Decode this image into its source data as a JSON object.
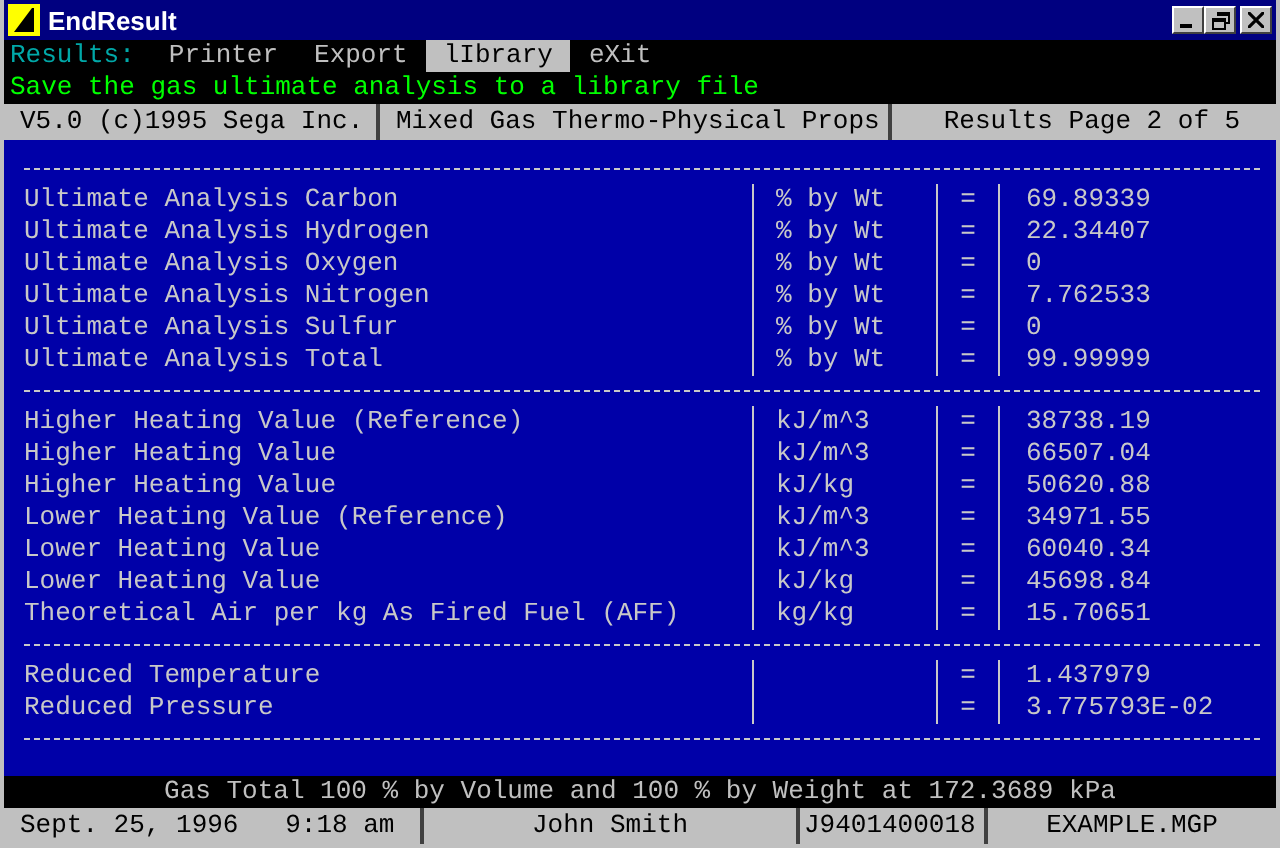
{
  "window": {
    "title": "EndResult"
  },
  "menu": {
    "label": "Results:",
    "items": [
      {
        "label": "Printer",
        "selected": false
      },
      {
        "label": "Export",
        "selected": false
      },
      {
        "label": "lIbrary",
        "selected": true
      },
      {
        "label": "eXit",
        "selected": false
      }
    ]
  },
  "message": "Save the gas ultimate analysis to a library file",
  "info_bar": [
    "V5.0 (c)1995 Sega Inc.",
    "Mixed Gas Thermo-Physical Props",
    "Results Page 2 of 5"
  ],
  "sections": [
    {
      "rows": [
        {
          "label": "Ultimate Analysis Carbon",
          "unit": "% by Wt",
          "relation": "=",
          "value": "69.89339"
        },
        {
          "label": "Ultimate Analysis Hydrogen",
          "unit": "% by Wt",
          "relation": "=",
          "value": "22.34407"
        },
        {
          "label": "Ultimate Analysis Oxygen",
          "unit": "% by Wt",
          "relation": "=",
          "value": "0"
        },
        {
          "label": "Ultimate Analysis Nitrogen",
          "unit": "% by Wt",
          "relation": "=",
          "value": "7.762533"
        },
        {
          "label": "Ultimate Analysis Sulfur",
          "unit": "% by Wt",
          "relation": "=",
          "value": "0"
        },
        {
          "label": "Ultimate Analysis Total",
          "unit": "% by Wt",
          "relation": "=",
          "value": "99.99999"
        }
      ]
    },
    {
      "rows": [
        {
          "label": "Higher Heating Value (Reference)",
          "unit": "kJ/m^3",
          "relation": "=",
          "value": "38738.19"
        },
        {
          "label": "Higher Heating Value",
          "unit": "kJ/m^3",
          "relation": "=",
          "value": "66507.04"
        },
        {
          "label": "Higher Heating Value",
          "unit": "kJ/kg",
          "relation": "=",
          "value": "50620.88"
        },
        {
          "label": "Lower Heating Value (Reference)",
          "unit": "kJ/m^3",
          "relation": "=",
          "value": "34971.55"
        },
        {
          "label": "Lower Heating Value",
          "unit": "kJ/m^3",
          "relation": "=",
          "value": "60040.34"
        },
        {
          "label": "Lower Heating Value",
          "unit": "kJ/kg",
          "relation": "=",
          "value": "45698.84"
        },
        {
          "label": "Theoretical Air per kg As Fired Fuel (AFF)",
          "unit": "kg/kg",
          "relation": "=",
          "value": "15.70651"
        }
      ]
    },
    {
      "rows": [
        {
          "label": "Reduced Temperature",
          "relation": "=",
          "value": "1.437979"
        },
        {
          "label": "Reduced Pressure",
          "relation": "=",
          "value": "3.775793E-02"
        }
      ]
    }
  ],
  "summary": "Gas Total 100 % by Volume and 100 % by Weight at 172.3689 kPa",
  "status_bar": [
    "Sept. 25, 1996   9:18 am",
    "John Smith",
    "J9401400018",
    "EXAMPLE.MGP"
  ]
}
